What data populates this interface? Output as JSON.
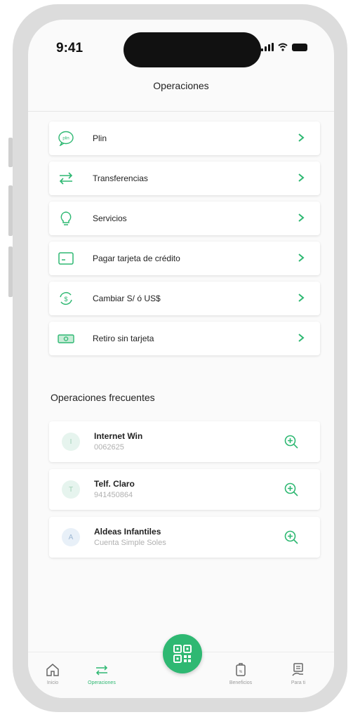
{
  "status_bar": {
    "time": "9:41"
  },
  "header": {
    "title": "Operaciones"
  },
  "operations": [
    {
      "label": "Plin",
      "icon": "plin-icon"
    },
    {
      "label": "Transferencias",
      "icon": "transfer-arrows-icon"
    },
    {
      "label": "Servicios",
      "icon": "lightbulb-icon"
    },
    {
      "label": "Pagar tarjeta de crédito",
      "icon": "credit-card-icon"
    },
    {
      "label": "Cambiar S/ ó US$",
      "icon": "currency-exchange-icon"
    },
    {
      "label": "Retiro sin tarjeta",
      "icon": "cash-withdrawal-icon"
    }
  ],
  "frequent": {
    "title": "Operaciones frecuentes",
    "items": [
      {
        "initial": "I",
        "name": "Internet Win",
        "detail": "0062625"
      },
      {
        "initial": "T",
        "name": "Telf. Claro",
        "detail": "941450864"
      },
      {
        "initial": "A",
        "name": "Aldeas Infantiles",
        "detail": "Cuenta Simple Soles"
      }
    ]
  },
  "tabbar": {
    "tabs": [
      {
        "label": "Inicio",
        "icon": "home-icon"
      },
      {
        "label": "Operaciones",
        "icon": "operations-icon"
      },
      {
        "label": "Beneficios",
        "icon": "benefits-icon"
      },
      {
        "label": "Para ti",
        "icon": "for-you-icon"
      }
    ],
    "center": {
      "icon": "qr-code-icon"
    }
  },
  "colors": {
    "accent": "#2eb872",
    "text": "#222222",
    "muted": "#b0b0b0"
  }
}
